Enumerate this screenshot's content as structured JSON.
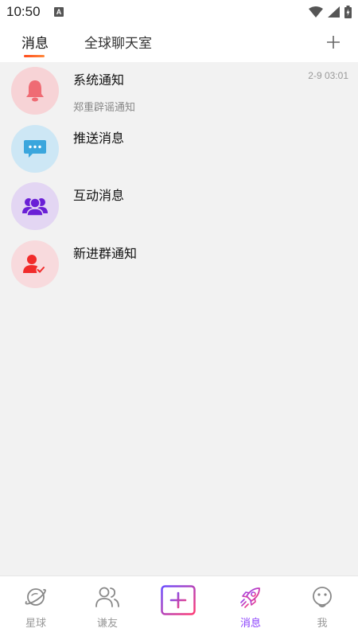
{
  "status_bar": {
    "time": "10:50",
    "badge": "A"
  },
  "top_tabs": [
    {
      "label": "消息",
      "active": true
    },
    {
      "label": "全球聊天室",
      "active": false
    }
  ],
  "messages": [
    {
      "title": "系统通知",
      "subtitle": "郑重辟谣通知",
      "time": "2-9 03:01",
      "icon": "bell-icon",
      "bg": "#f7d3d6",
      "color": "#ef6b74"
    },
    {
      "title": "推送消息",
      "subtitle": "",
      "time": "",
      "icon": "chat-bubble-icon",
      "bg": "#cde7f5",
      "color": "#3aa6dd"
    },
    {
      "title": "互动消息",
      "subtitle": "",
      "time": "",
      "icon": "group-icon",
      "bg": "#e3d6f3",
      "color": "#6a1fd6"
    },
    {
      "title": "新进群通知",
      "subtitle": "",
      "time": "",
      "icon": "user-check-icon",
      "bg": "#f8dadd",
      "color": "#f12b2b"
    }
  ],
  "bottom_nav": [
    {
      "label": "星球",
      "icon": "planet-icon",
      "active": false
    },
    {
      "label": "谦友",
      "icon": "friends-icon",
      "active": false
    },
    {
      "label": "",
      "icon": "publish-plus-icon",
      "active": false
    },
    {
      "label": "消息",
      "icon": "rocket-icon",
      "active": true
    },
    {
      "label": "我",
      "icon": "smiley-icon",
      "active": false
    }
  ],
  "colors": {
    "accent": "#8a3ffc",
    "tab_underline": "#ff5a24"
  }
}
